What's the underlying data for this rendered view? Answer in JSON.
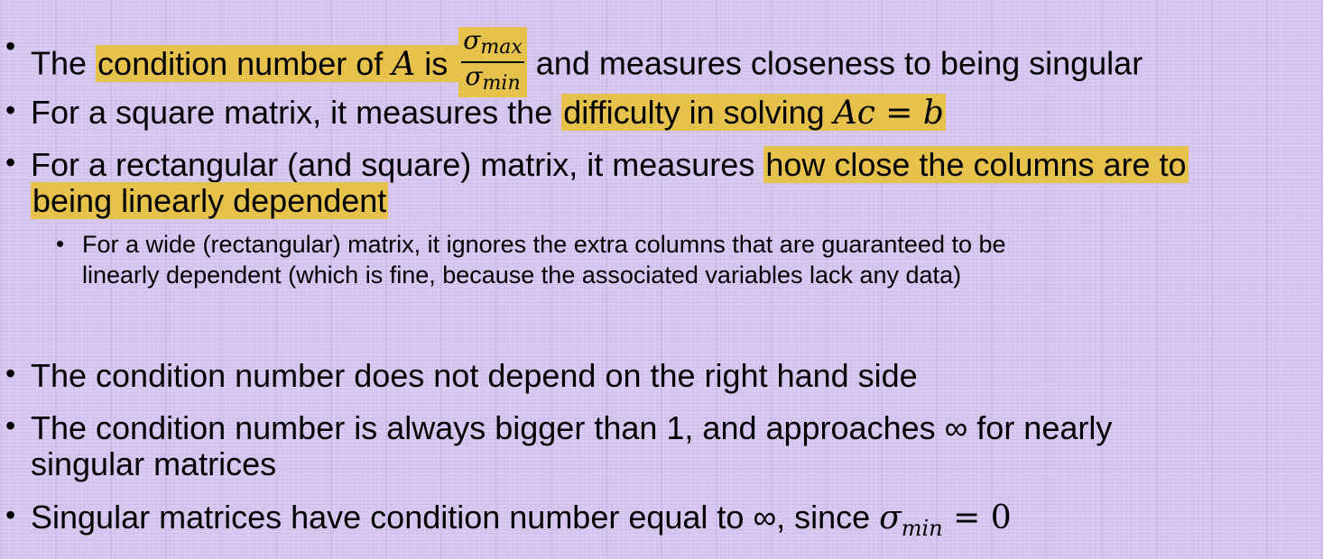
{
  "bullets": [
    {
      "pre": "The ",
      "hl": "condition number of ",
      "var": "A",
      "hl2": " is ",
      "frac_num": "σmax",
      "frac_den": "σmin",
      "post": " and measures closeness to being singular"
    },
    {
      "pre": "For a square matrix, it measures the ",
      "hl": "difficulty in solving ",
      "eq": "Ac = b"
    },
    {
      "pre": "For a rectangular (and square) matrix, it measures ",
      "hl": "how close the columns are to",
      "hl_line2": "being linearly dependent"
    },
    {
      "line1": "For a wide (rectangular) matrix, it ignores the extra columns that are guaranteed to be",
      "line2": "linearly dependent (which is fine, because the associated variables lack any data)"
    },
    {
      "text": "The condition number does not depend on the right hand side"
    },
    {
      "line1": "The condition number is always bigger than 1, and approaches ∞ for nearly",
      "line2": "singular matrices"
    },
    {
      "pre": "Singular matrices have condition number equal to ∞, since ",
      "sigma": "σ",
      "sub": "min",
      "post": " = 0"
    }
  ],
  "bullet_glyph": "•",
  "highlight_color": "#e6c24d",
  "background_color": "#d6c6f0"
}
